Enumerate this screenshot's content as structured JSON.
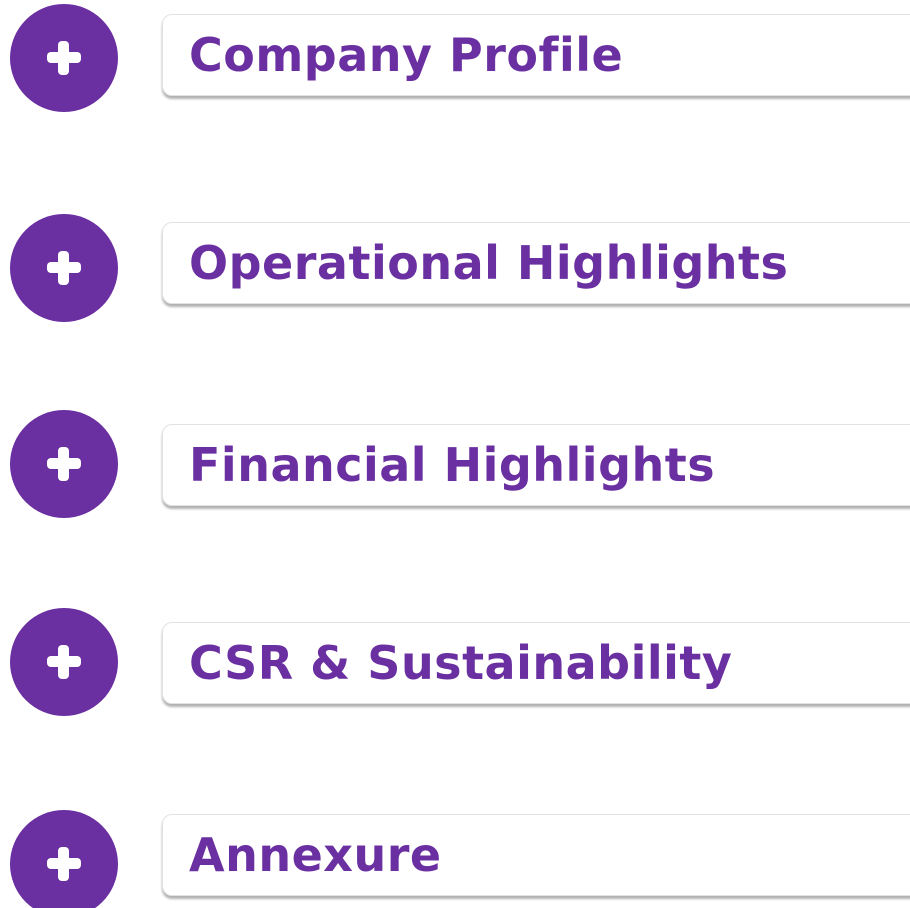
{
  "accordion": {
    "accent_color": "#6a2fa0",
    "items": [
      {
        "icon": "plus-icon",
        "label": "Company Profile"
      },
      {
        "icon": "plus-icon",
        "label": "Operational Highlights"
      },
      {
        "icon": "plus-icon",
        "label": "Financial Highlights"
      },
      {
        "icon": "plus-icon",
        "label": "CSR & Sustainability"
      },
      {
        "icon": "plus-icon",
        "label": "Annexure"
      }
    ]
  }
}
